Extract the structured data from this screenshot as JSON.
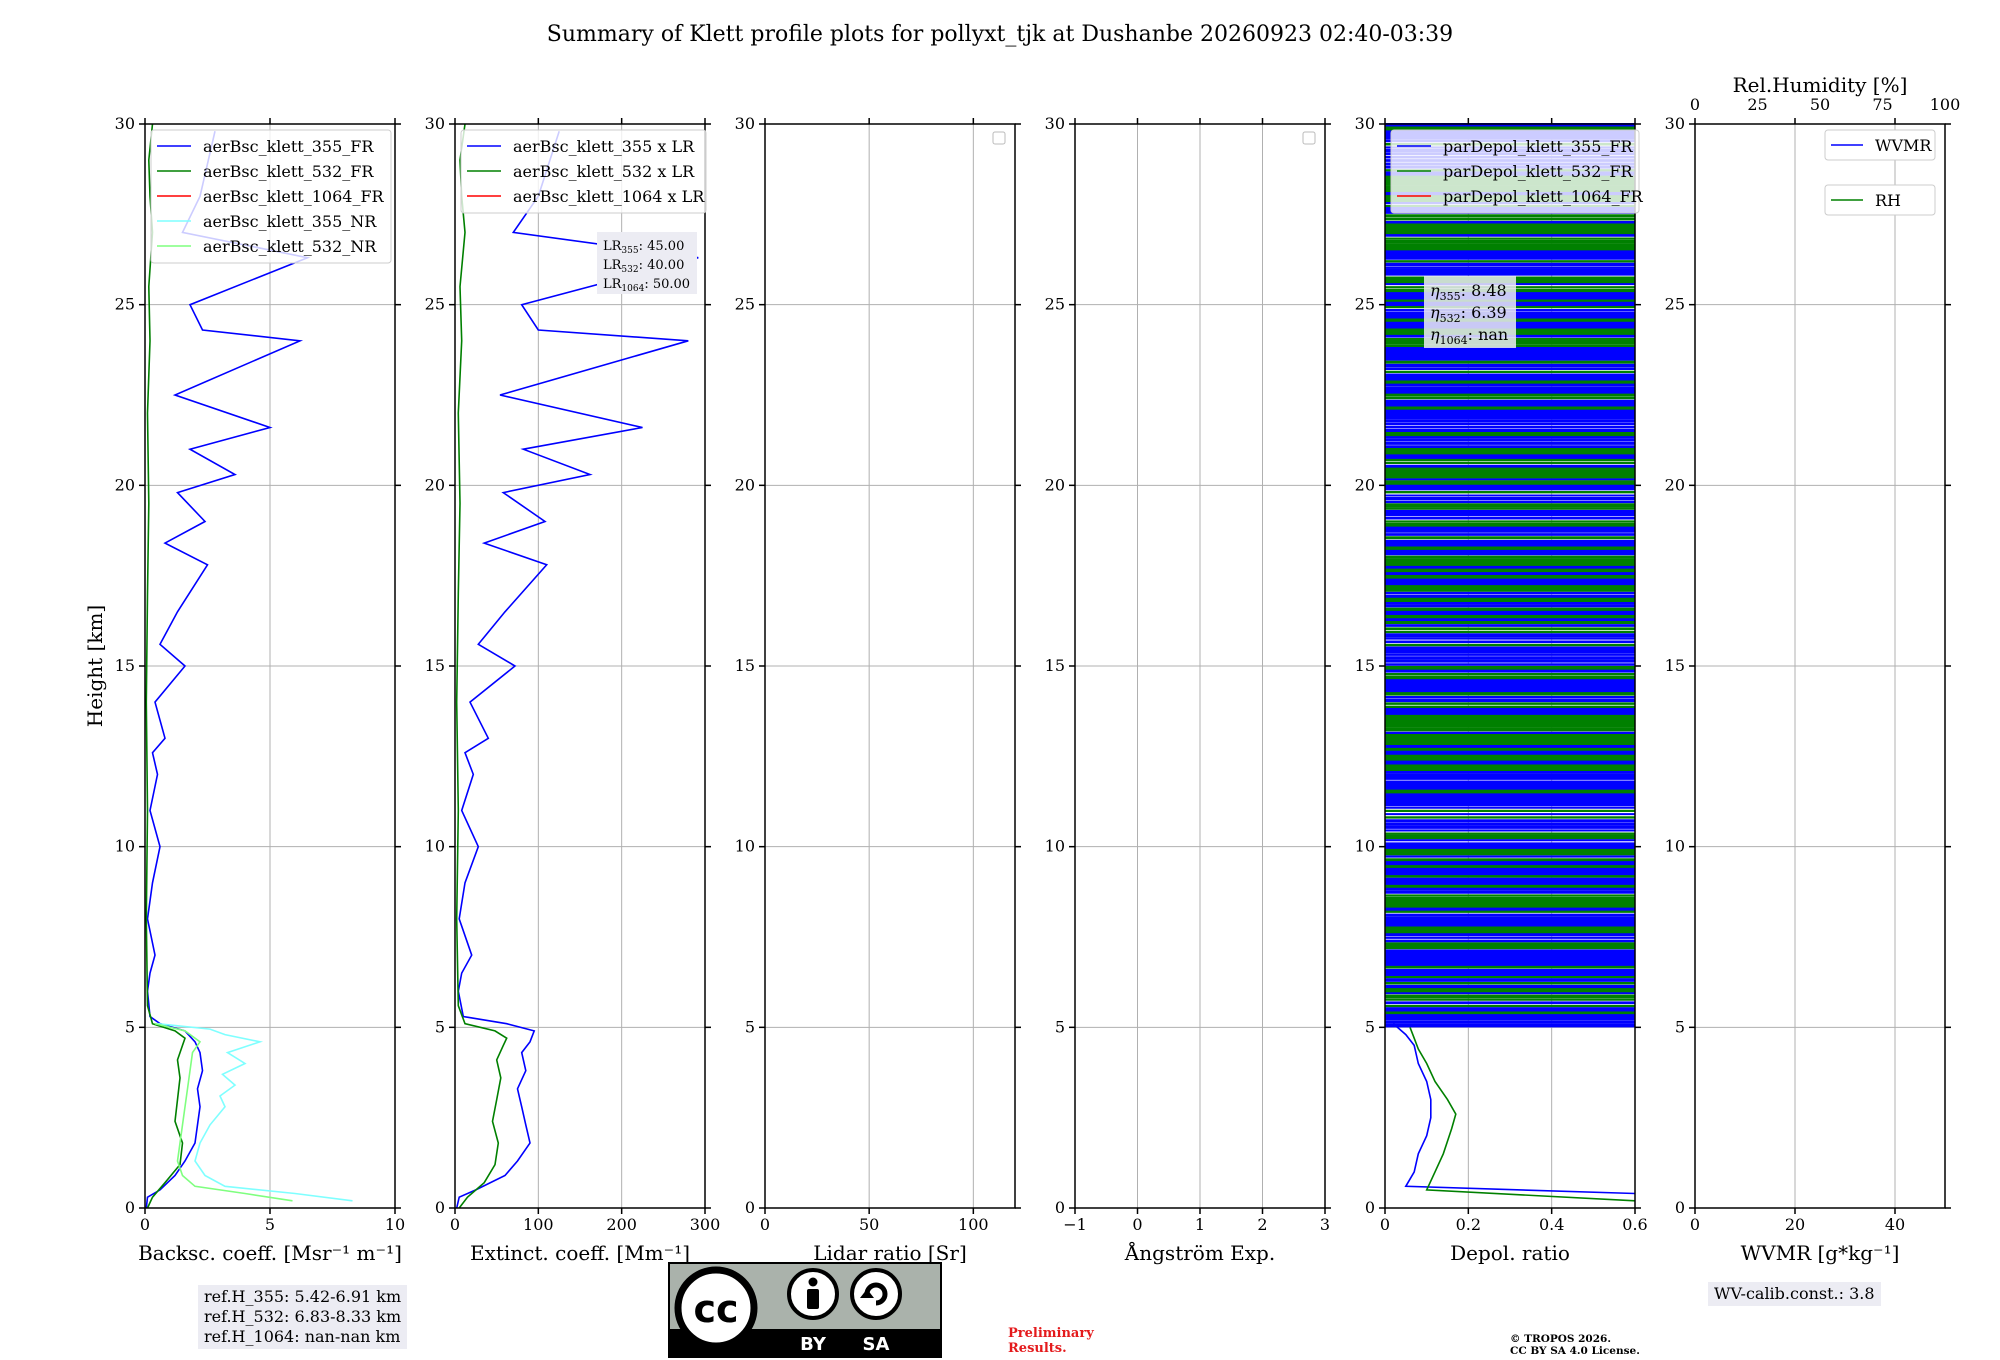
{
  "title": "Summary of Klett profile plots for pollyxt_tjk at Dushanbe 20260923 02:40-03:39",
  "colors": {
    "c355": "#0000ff",
    "c532": "#008000",
    "c1064": "#ff0000",
    "c355nr": "#7fffff",
    "c532nr": "#7fff7f",
    "grid": "#b0b0b0"
  },
  "ref_heights": [
    "ref.H_355: 5.42-6.91 km",
    "ref.H_532: 6.83-8.33 km",
    "ref.H_1064: nan-nan km"
  ],
  "lidar_ratios": [
    "LR355: 45.00",
    "LR532: 40.00",
    "LR1064: 50.00"
  ],
  "eta_values": [
    "η355: 8.48",
    "η532: 6.39",
    "η1064: nan"
  ],
  "wv_calib": "WV-calib.const.: 3.8",
  "license_badge": {
    "by": "BY",
    "sa": "SA"
  },
  "preliminary": [
    "Preliminary",
    "Results."
  ],
  "copyright": [
    "© TROPOS 2026.",
    "CC BY SA 4.0 License."
  ],
  "chart_data": [
    {
      "type": "line",
      "panel": "backscatter",
      "xlabel": "Backsc. coeff. [Msr⁻¹ m⁻¹]",
      "ylabel": "Height [km]",
      "xlim": [
        0,
        10
      ],
      "ylim": [
        0,
        30
      ],
      "xticks": [
        0,
        5,
        10
      ],
      "yticks": [
        0,
        5,
        10,
        15,
        20,
        25,
        30
      ],
      "grid": true,
      "legend": "top",
      "series": [
        {
          "name": "aerBsc_klett_355_FR",
          "color": "#0000ff",
          "x": [
            0.05,
            0.1,
            0.6,
            1.2,
            1.6,
            2.0,
            2.1,
            2.2,
            2.1,
            2.3,
            2.2,
            2.0,
            1.6,
            0.6,
            0.2,
            0.1,
            0.2,
            0.4,
            0.1,
            0.3,
            0.6,
            0.2,
            0.5,
            0.3,
            0.8,
            0.4,
            1.6,
            0.6,
            1.3,
            2.5,
            0.8,
            2.4,
            1.3,
            3.6,
            1.8,
            5.0,
            1.2,
            6.2,
            2.3,
            1.8,
            6.5,
            1.5,
            2.2,
            2.8
          ],
          "y": [
            0,
            0.3,
            0.5,
            0.9,
            1.3,
            1.8,
            2.3,
            2.8,
            3.3,
            3.8,
            4.3,
            4.6,
            4.9,
            5.1,
            5.3,
            6,
            6.5,
            7,
            8,
            9,
            10,
            11,
            12,
            12.6,
            13,
            14,
            15,
            15.6,
            16.5,
            17.8,
            18.4,
            19,
            19.8,
            20.3,
            21,
            21.6,
            22.5,
            24,
            24.3,
            25,
            26.3,
            27,
            28,
            29.8
          ]
        },
        {
          "name": "aerBsc_klett_532_FR",
          "color": "#008000",
          "x": [
            0.1,
            0.3,
            0.8,
            1.4,
            1.5,
            1.2,
            1.3,
            1.4,
            1.3,
            1.5,
            1.6,
            1.2,
            0.3,
            0.1,
            0.05,
            0.1,
            0.05,
            0.1,
            0.15,
            0.1,
            0.2,
            0.15,
            0.3,
            0.2,
            0.15,
            0.3
          ],
          "y": [
            0,
            0.3,
            0.7,
            1.2,
            1.8,
            2.4,
            3,
            3.6,
            4.1,
            4.5,
            4.7,
            4.9,
            5.1,
            5.6,
            8,
            11,
            14,
            17,
            19.5,
            22,
            24,
            25.5,
            27,
            28,
            29,
            30
          ]
        },
        {
          "name": "aerBsc_klett_1064_FR",
          "color": "#ff0000",
          "x": [],
          "y": []
        },
        {
          "name": "aerBsc_klett_355_NR",
          "color": "#7fffff",
          "x": [
            8.3,
            6.0,
            3.2,
            2.4,
            2.0,
            2.2,
            2.6,
            3.2,
            3.0,
            3.6,
            3.1,
            4.0,
            3.3,
            4.6,
            3.2,
            2.6,
            0.5
          ],
          "y": [
            0.2,
            0.4,
            0.6,
            0.9,
            1.3,
            1.8,
            2.3,
            2.8,
            3.1,
            3.4,
            3.7,
            4.0,
            4.3,
            4.6,
            4.8,
            4.95,
            5.1
          ]
        },
        {
          "name": "aerBsc_klett_532_NR",
          "color": "#7fff7f",
          "x": [
            5.9,
            4.0,
            2.0,
            1.5,
            1.3,
            1.4,
            1.5,
            1.6,
            1.7,
            1.8,
            1.9,
            2.2,
            1.6,
            0.4
          ],
          "y": [
            0.2,
            0.4,
            0.6,
            0.9,
            1.3,
            1.8,
            2.3,
            2.8,
            3.3,
            3.8,
            4.3,
            4.6,
            4.9,
            5.1
          ]
        }
      ]
    },
    {
      "type": "line",
      "panel": "extinction",
      "xlabel": "Extinct. coeff. [Mm⁻¹]",
      "xlim": [
        0,
        300
      ],
      "ylim": [
        0,
        30
      ],
      "xticks": [
        0,
        100,
        200,
        300
      ],
      "yticks": [
        0,
        5,
        10,
        15,
        20,
        25,
        30
      ],
      "grid": true,
      "legend": "top",
      "series": [
        {
          "name": "aerBsc_klett_355 x LR",
          "color": "#0000ff",
          "x": [
            2,
            5,
            25,
            60,
            75,
            90,
            85,
            80,
            75,
            85,
            80,
            90,
            95,
            62,
            10,
            4,
            8,
            20,
            5,
            12,
            28,
            8,
            22,
            12,
            40,
            18,
            72,
            28,
            60,
            110,
            35,
            108,
            58,
            162,
            82,
            225,
            54,
            280,
            100,
            80,
            292,
            70,
            100,
            125
          ],
          "y": [
            0,
            0.3,
            0.5,
            0.9,
            1.3,
            1.8,
            2.3,
            2.8,
            3.3,
            3.8,
            4.3,
            4.6,
            4.9,
            5.1,
            5.3,
            6,
            6.5,
            7,
            8,
            9,
            10,
            11,
            12,
            12.6,
            13,
            14,
            15,
            15.6,
            16.5,
            17.8,
            18.4,
            19,
            19.8,
            20.3,
            21,
            21.6,
            22.5,
            24,
            24.3,
            25,
            26.3,
            27,
            28,
            29.8
          ]
        },
        {
          "name": "aerBsc_klett_532 x LR",
          "color": "#008000",
          "x": [
            5,
            15,
            35,
            48,
            52,
            45,
            50,
            55,
            50,
            58,
            62,
            48,
            12,
            4,
            2,
            4,
            2,
            4,
            6,
            4,
            8,
            6,
            12,
            8,
            6,
            12
          ],
          "y": [
            0,
            0.3,
            0.7,
            1.2,
            1.8,
            2.4,
            3,
            3.6,
            4.1,
            4.5,
            4.7,
            4.9,
            5.1,
            5.6,
            8,
            11,
            14,
            17,
            19.5,
            22,
            24,
            25.5,
            27,
            28,
            29,
            30
          ]
        },
        {
          "name": "aerBsc_klett_1064 x LR",
          "color": "#ff0000",
          "x": [],
          "y": []
        }
      ]
    },
    {
      "type": "line",
      "panel": "lidar_ratio",
      "xlabel": "Lidar ratio [Sr]",
      "xlim": [
        0,
        120
      ],
      "ylim": [
        0,
        30
      ],
      "xticks": [
        0,
        50,
        100
      ],
      "yticks": [
        0,
        5,
        10,
        15,
        20,
        25,
        30
      ],
      "grid": true,
      "legend": "top-right",
      "series": []
    },
    {
      "type": "line",
      "panel": "angstrom",
      "xlabel": "Ångström Exp.",
      "xlim": [
        -1,
        3
      ],
      "ylim": [
        0,
        30
      ],
      "xticks": [
        -1,
        0,
        1,
        2,
        3
      ],
      "yticks": [
        0,
        5,
        10,
        15,
        20,
        25,
        30
      ],
      "grid": true,
      "legend": "top-right",
      "series": []
    },
    {
      "type": "line",
      "panel": "depol",
      "xlabel": "Depol. ratio",
      "xlim": [
        0,
        0.6
      ],
      "ylim": [
        0,
        30
      ],
      "xticks": [
        0,
        0.2,
        0.4,
        0.6
      ],
      "yticks": [
        0,
        5,
        10,
        15,
        20,
        25,
        30
      ],
      "grid": true,
      "legend": "top",
      "series": [
        {
          "name": "parDepol_klett_355_FR",
          "color": "#0000ff",
          "x": [
            0.6,
            0.05,
            0.07,
            0.08,
            0.1,
            0.11,
            0.11,
            0.1,
            0.08,
            0.07,
            0.05,
            0.02
          ],
          "y": [
            0.4,
            0.6,
            1.0,
            1.5,
            2.0,
            2.5,
            3.0,
            3.5,
            4.0,
            4.5,
            4.8,
            5.1
          ]
        },
        {
          "name": "parDepol_klett_532_FR",
          "color": "#008000",
          "x": [
            0.6,
            0.1,
            0.12,
            0.14,
            0.16,
            0.17,
            0.15,
            0.12,
            0.1,
            0.08,
            0.07,
            0.06
          ],
          "y": [
            0.2,
            0.5,
            1.0,
            1.5,
            2.2,
            2.6,
            3.0,
            3.5,
            4.0,
            4.4,
            4.7,
            5.0
          ]
        },
        {
          "name": "parDepol_klett_1064_FR",
          "color": "#ff0000",
          "x": [],
          "y": []
        }
      ]
    },
    {
      "type": "line",
      "panel": "wvmr",
      "xlabel": "WVMR [g*kg⁻¹]",
      "x2label": "Rel.Humidity [%]",
      "xlim": [
        0,
        50
      ],
      "x2lim": [
        0,
        100
      ],
      "ylim": [
        0,
        30
      ],
      "xticks": [
        0,
        20,
        40
      ],
      "x2ticks": [
        0,
        25,
        50,
        75,
        100
      ],
      "yticks": [
        0,
        5,
        10,
        15,
        20,
        25,
        30
      ],
      "grid": true,
      "legend": "top-right",
      "series": [
        {
          "name": "WVMR",
          "color": "#0000ff",
          "x": [],
          "y": []
        },
        {
          "name": "RH",
          "color": "#008000",
          "x": [],
          "y": []
        }
      ]
    }
  ]
}
